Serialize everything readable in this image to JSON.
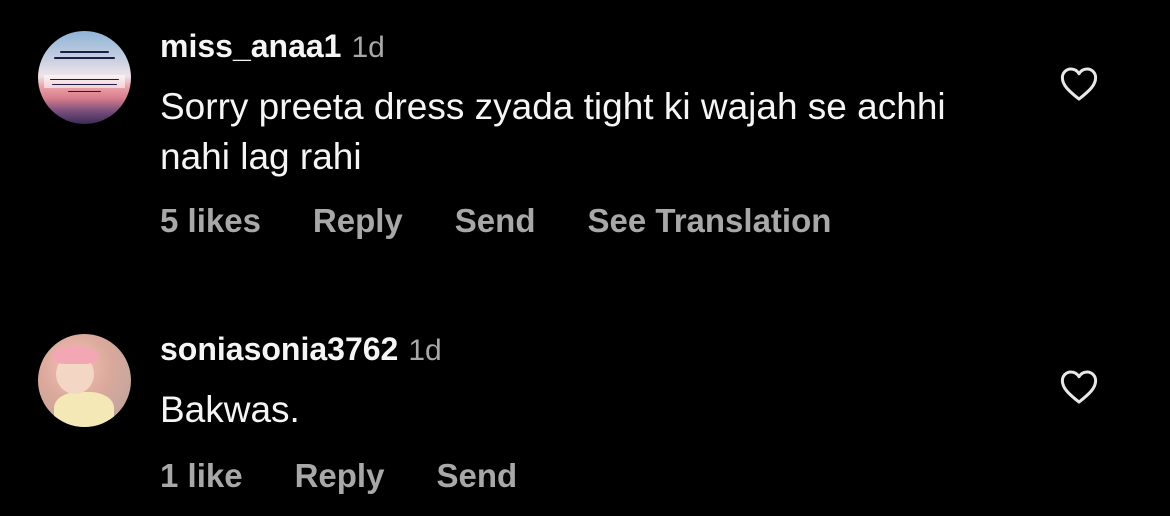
{
  "comments": [
    {
      "username": "miss_anaa1",
      "time": "1d",
      "text": "Sorry preeta dress zyada tight ki wajah se achhi nahi lag rahi",
      "likes": "5 likes",
      "reply": "Reply",
      "send": "Send",
      "translate": "See Translation",
      "like_icon": "heart-outline-icon"
    },
    {
      "username": "soniasonia3762",
      "time": "1d",
      "text": "Bakwas.",
      "likes": "1 like",
      "reply": "Reply",
      "send": "Send",
      "like_icon": "heart-outline-icon"
    }
  ],
  "colors": {
    "background": "#000000",
    "primary_text": "#f5f5f5",
    "secondary_text": "#a8a8a8"
  }
}
